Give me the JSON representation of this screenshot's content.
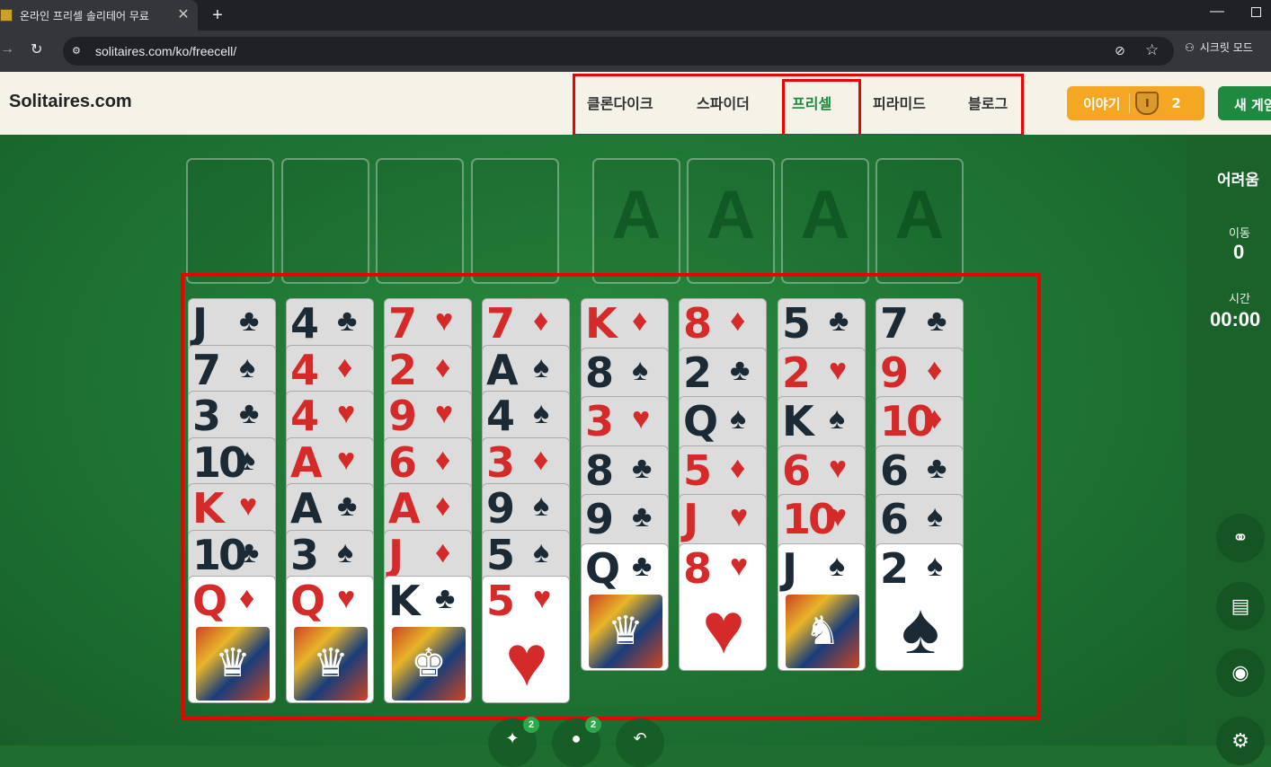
{
  "browser": {
    "tab_title": "온라인 프리셀 솔리테어 무료 ",
    "tab_close": "✕",
    "new_tab": "+",
    "url": "solitaires.com/ko/freecell/",
    "incognito_label": "시크릿 모드"
  },
  "header": {
    "logo": "Solitaires.com",
    "nav": [
      "클론다이크",
      "스파이더",
      "프리셀",
      "피라미드",
      "블로그"
    ],
    "active_nav": "프리셀",
    "story_label": "이야기",
    "story_count": "2",
    "new_game_label": "새 게임"
  },
  "sidebar": {
    "difficulty": "어려움",
    "moves_label": "이동",
    "moves_value": "0",
    "time_label": "시간",
    "time_value": "00:00"
  },
  "foundations": [
    "A",
    "A",
    "A",
    "A"
  ],
  "tableau": [
    [
      [
        "J",
        "♣",
        "black"
      ],
      [
        "7",
        "♠",
        "black"
      ],
      [
        "3",
        "♣",
        "black"
      ],
      [
        "10",
        "♠",
        "black"
      ],
      [
        "K",
        "♥",
        "red"
      ],
      [
        "10",
        "♣",
        "black"
      ],
      [
        "Q",
        "♦",
        "red"
      ]
    ],
    [
      [
        "4",
        "♣",
        "black"
      ],
      [
        "4",
        "♦",
        "red"
      ],
      [
        "4",
        "♥",
        "red"
      ],
      [
        "A",
        "♥",
        "red"
      ],
      [
        "A",
        "♣",
        "black"
      ],
      [
        "3",
        "♠",
        "black"
      ],
      [
        "Q",
        "♥",
        "red"
      ]
    ],
    [
      [
        "7",
        "♥",
        "red"
      ],
      [
        "2",
        "♦",
        "red"
      ],
      [
        "9",
        "♥",
        "red"
      ],
      [
        "6",
        "♦",
        "red"
      ],
      [
        "A",
        "♦",
        "red"
      ],
      [
        "J",
        "♦",
        "red"
      ],
      [
        "K",
        "♣",
        "black"
      ]
    ],
    [
      [
        "7",
        "♦",
        "red"
      ],
      [
        "A",
        "♠",
        "black"
      ],
      [
        "4",
        "♠",
        "black"
      ],
      [
        "3",
        "♦",
        "red"
      ],
      [
        "9",
        "♠",
        "black"
      ],
      [
        "5",
        "♠",
        "black"
      ],
      [
        "5",
        "♥",
        "red"
      ]
    ],
    [
      [
        "K",
        "♦",
        "red"
      ],
      [
        "8",
        "♠",
        "black"
      ],
      [
        "3",
        "♥",
        "red"
      ],
      [
        "8",
        "♣",
        "black"
      ],
      [
        "9",
        "♣",
        "black"
      ],
      [
        "Q",
        "♣",
        "black"
      ]
    ],
    [
      [
        "8",
        "♦",
        "red"
      ],
      [
        "2",
        "♣",
        "black"
      ],
      [
        "Q",
        "♠",
        "black"
      ],
      [
        "5",
        "♦",
        "red"
      ],
      [
        "J",
        "♥",
        "red"
      ],
      [
        "8",
        "♥",
        "red"
      ]
    ],
    [
      [
        "5",
        "♣",
        "black"
      ],
      [
        "2",
        "♥",
        "red"
      ],
      [
        "K",
        "♠",
        "black"
      ],
      [
        "6",
        "♥",
        "red"
      ],
      [
        "10",
        "♥",
        "red"
      ],
      [
        "J",
        "♠",
        "black"
      ]
    ],
    [
      [
        "7",
        "♣",
        "black"
      ],
      [
        "9",
        "♦",
        "red"
      ],
      [
        "10",
        "♦",
        "red"
      ],
      [
        "6",
        "♣",
        "black"
      ],
      [
        "6",
        "♠",
        "black"
      ],
      [
        "2",
        "♠",
        "black"
      ]
    ]
  ],
  "bottom": {
    "hint_badge": "2",
    "second_badge": "2"
  }
}
